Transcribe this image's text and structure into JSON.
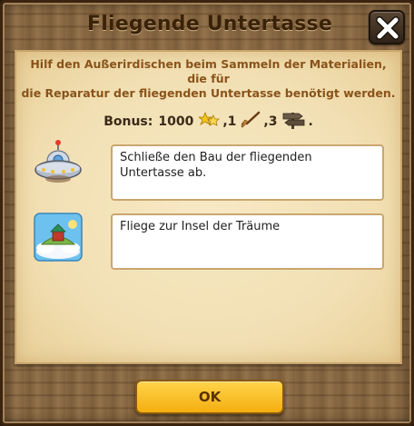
{
  "dialog": {
    "title": "Fliegende Untertasse",
    "close_icon": "close-x-icon",
    "intro_line1": "Hilf den Außerirdischen beim Sammeln der Materialien, die für",
    "intro_line2": "die Reparatur der fliegenden Untertasse benötigt werden."
  },
  "bonus": {
    "label": "Bonus:",
    "amount": "1000",
    "star_icon": "gold-stars-icon",
    "star_count": ",1",
    "broom_icon": "broom-icon",
    "broom_count": ",3",
    "signpost_icon": "signpost-icon",
    "signpost_count": "."
  },
  "tasks": [
    {
      "icon": "ufo-icon",
      "text": "Schließe den Bau der fliegenden Untertasse ab."
    },
    {
      "icon": "dream-island-icon",
      "text": "Fliege zur Insel der Träume"
    }
  ],
  "footer": {
    "ok_label": "OK"
  },
  "colors": {
    "wood": "#8a6a45",
    "parchment": "#f4e4bb",
    "intro_text": "#8a531a",
    "ok_button": "#f7b81b"
  }
}
